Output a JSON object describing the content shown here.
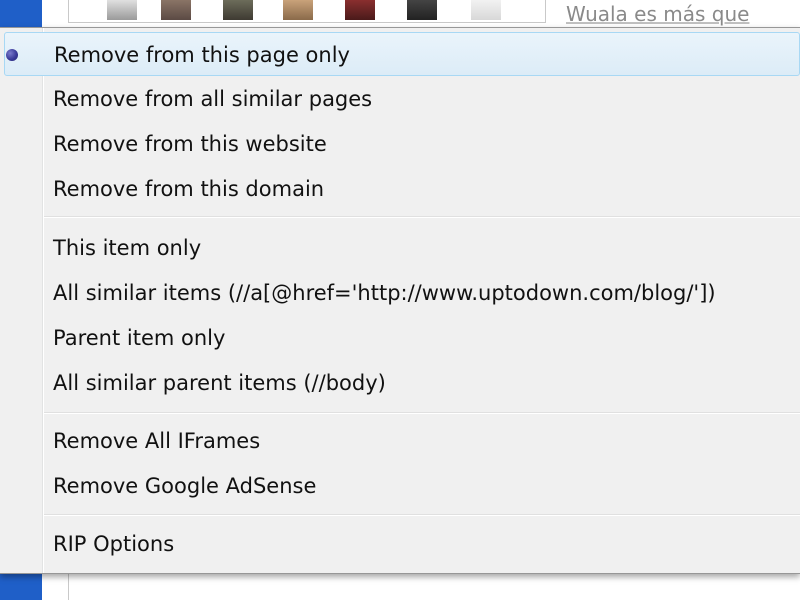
{
  "background": {
    "snippet_text": "Wuala es más que",
    "thumbnails": [
      "thumbnail-1",
      "thumbnail-2",
      "thumbnail-3",
      "thumbnail-4",
      "thumbnail-5",
      "thumbnail-6",
      "thumbnail-7"
    ],
    "colors": {
      "left_bar": "#1f5fc8"
    }
  },
  "context_menu": {
    "group_remove": {
      "items": [
        {
          "label": "Remove from this page only",
          "selected": true
        },
        {
          "label": "Remove from all similar pages",
          "selected": false
        },
        {
          "label": "Remove from this website",
          "selected": false
        },
        {
          "label": "Remove from this domain",
          "selected": false
        }
      ]
    },
    "group_scope": {
      "items": [
        {
          "label": "This item only"
        },
        {
          "label": "All similar items (//a[@href='http://www.uptodown.com/blog/'])"
        },
        {
          "label": "Parent item only"
        },
        {
          "label": "All similar parent items (//body)"
        }
      ]
    },
    "group_presets": {
      "items": [
        {
          "label": "Remove All IFrames"
        },
        {
          "label": "Remove Google AdSense"
        }
      ]
    },
    "group_options": {
      "items": [
        {
          "label": "RIP Options"
        }
      ]
    },
    "colors": {
      "highlight_border": "#a8d8f4",
      "bullet": "#3b3b9a",
      "menu_bg": "#f0f0f0"
    }
  }
}
